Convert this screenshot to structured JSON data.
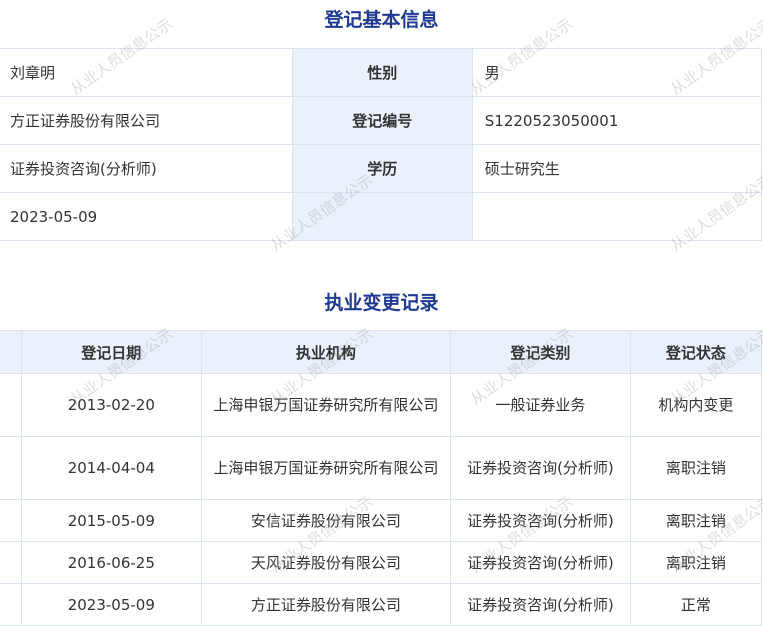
{
  "basic": {
    "title": "登记基本信息",
    "rows": [
      {
        "value": "刘章明",
        "label": "性别",
        "value2": "男"
      },
      {
        "value": "方正证券股份有限公司",
        "label": "登记编号",
        "value2": "S1220523050001"
      },
      {
        "value": "证券投资咨询(分析师)",
        "label": "学历",
        "value2": "硕士研究生"
      },
      {
        "value": "2023-05-09",
        "label": "",
        "value2": ""
      }
    ]
  },
  "records": {
    "title": "执业变更记录",
    "headers": [
      "登记日期",
      "执业机构",
      "登记类别",
      "登记状态"
    ],
    "rows": [
      {
        "date": "2013-02-20",
        "org": "上海申银万国证券研究所有限公司",
        "category": "一般证券业务",
        "status": "机构内变更"
      },
      {
        "date": "2014-04-04",
        "org": "上海申银万国证券研究所有限公司",
        "category": "证券投资咨询(分析师)",
        "status": "离职注销"
      },
      {
        "date": "2015-05-09",
        "org": "安信证券股份有限公司",
        "category": "证券投资咨询(分析师)",
        "status": "离职注销"
      },
      {
        "date": "2016-06-25",
        "org": "天风证券股份有限公司",
        "category": "证券投资咨询(分析师)",
        "status": "离职注销"
      },
      {
        "date": "2023-05-09",
        "org": "方正证券股份有限公司",
        "category": "证券投资咨询(分析师)",
        "status": "正常"
      }
    ]
  },
  "watermark": "从业人员信息公示",
  "colors": {
    "title": "#1f3a93",
    "label_bg": "#eaf1fb",
    "border": "#dbe3f1"
  }
}
